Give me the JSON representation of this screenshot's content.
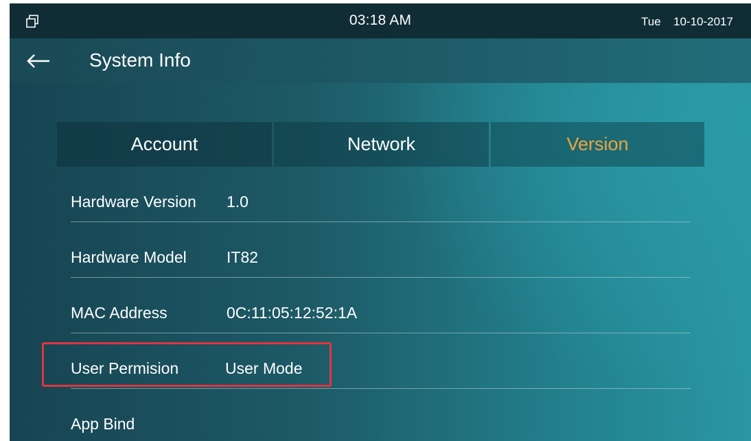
{
  "statusbar": {
    "window_icon": "window-stack-icon",
    "time": "03:18 AM",
    "day": "Tue",
    "date": "10-10-2017"
  },
  "titlebar": {
    "back_icon": "back-arrow-icon",
    "title": "System Info"
  },
  "tabs": [
    {
      "label": "Account",
      "active": false
    },
    {
      "label": "Network",
      "active": false
    },
    {
      "label": "Version",
      "active": true
    }
  ],
  "info": [
    {
      "label": "Hardware Version",
      "value": "1.0"
    },
    {
      "label": "Hardware Model",
      "value": "IT82"
    },
    {
      "label": "MAC Address",
      "value": "0C:11:05:12:52:1A"
    },
    {
      "label": "User Permision",
      "value": "User Mode",
      "highlighted": true
    },
    {
      "label": "App Bind",
      "value": ""
    }
  ],
  "colors": {
    "active_tab": "#f0a43c",
    "highlight_border": "#e2333f",
    "statusbar_bg": "#102d36"
  }
}
